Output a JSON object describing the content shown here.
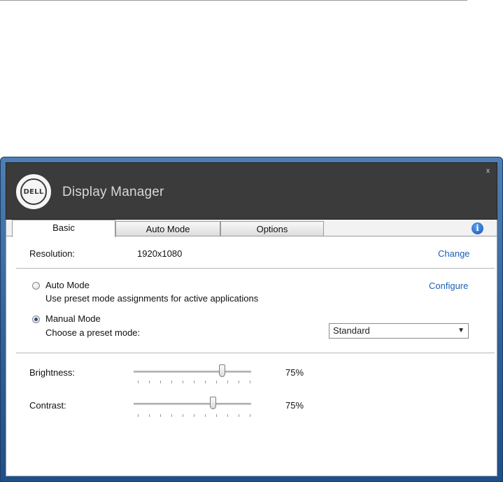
{
  "window": {
    "title": "Display Manager",
    "logo_text": "DELL",
    "close_glyph": "x"
  },
  "tabs": [
    {
      "label": "Basic",
      "active": true
    },
    {
      "label": "Auto Mode",
      "active": false
    },
    {
      "label": "Options",
      "active": false
    }
  ],
  "info_icon": "info-icon",
  "resolution": {
    "label": "Resolution:",
    "value": "1920x1080",
    "change_link": "Change"
  },
  "auto_mode": {
    "label": "Auto Mode",
    "description": "Use preset mode assignments for active applications",
    "configure_link": "Configure",
    "checked": false
  },
  "manual_mode": {
    "label": "Manual Mode",
    "description": "Choose a preset mode:",
    "checked": true,
    "preset_selected": "Standard"
  },
  "brightness": {
    "label": "Brightness:",
    "value_text": "75%",
    "level": 0.75
  },
  "contrast": {
    "label": "Contrast:",
    "value_text": "75%",
    "level": 0.67
  },
  "colors": {
    "titlebar": "#3b3b3b",
    "link": "#1d5fb6",
    "window_frame": "#2f5f96"
  }
}
